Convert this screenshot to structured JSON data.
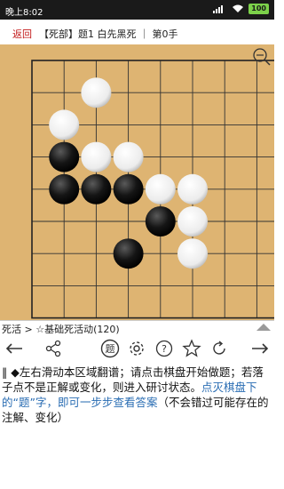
{
  "status": {
    "time": "晚上8:02",
    "battery": "100"
  },
  "header": {
    "back_label": "返回",
    "title": "【死部】题1 白先黑死 ｜ 第0手"
  },
  "board": {
    "size": 19,
    "visible_cols": 8,
    "visible_rows": 8,
    "stones": [
      {
        "color": "white",
        "col": 2,
        "row": 1
      },
      {
        "color": "white",
        "col": 1,
        "row": 2
      },
      {
        "color": "black",
        "col": 1,
        "row": 3
      },
      {
        "color": "white",
        "col": 2,
        "row": 3
      },
      {
        "color": "white",
        "col": 3,
        "row": 3
      },
      {
        "color": "black",
        "col": 1,
        "row": 4
      },
      {
        "color": "black",
        "col": 2,
        "row": 4
      },
      {
        "color": "black",
        "col": 3,
        "row": 4
      },
      {
        "color": "white",
        "col": 4,
        "row": 4
      },
      {
        "color": "white",
        "col": 5,
        "row": 4
      },
      {
        "color": "black",
        "col": 4,
        "row": 5
      },
      {
        "color": "white",
        "col": 5,
        "row": 5
      },
      {
        "color": "black",
        "col": 3,
        "row": 6
      },
      {
        "color": "white",
        "col": 5,
        "row": 6
      }
    ]
  },
  "breadcrumb": "死活 > ☆基础死活动(120)",
  "toolbar": {
    "prev": "prev-arrow",
    "share": "share-icon",
    "problem_label": "题",
    "settings": "gear-icon",
    "help": "question-icon",
    "favorite": "star-icon",
    "refresh": "refresh-icon",
    "next": "next-arrow"
  },
  "description": {
    "bullet": "‖",
    "part1": "◆左右滑动本区域翻谱；请点击棋盘开始做题；若落子点不是正解或变化，则进入研讨状态。",
    "link": "点灭棋盘下的“题”字，即可一步步查看答案",
    "part2": "（不会错过可能存在的注解、变化）"
  }
}
